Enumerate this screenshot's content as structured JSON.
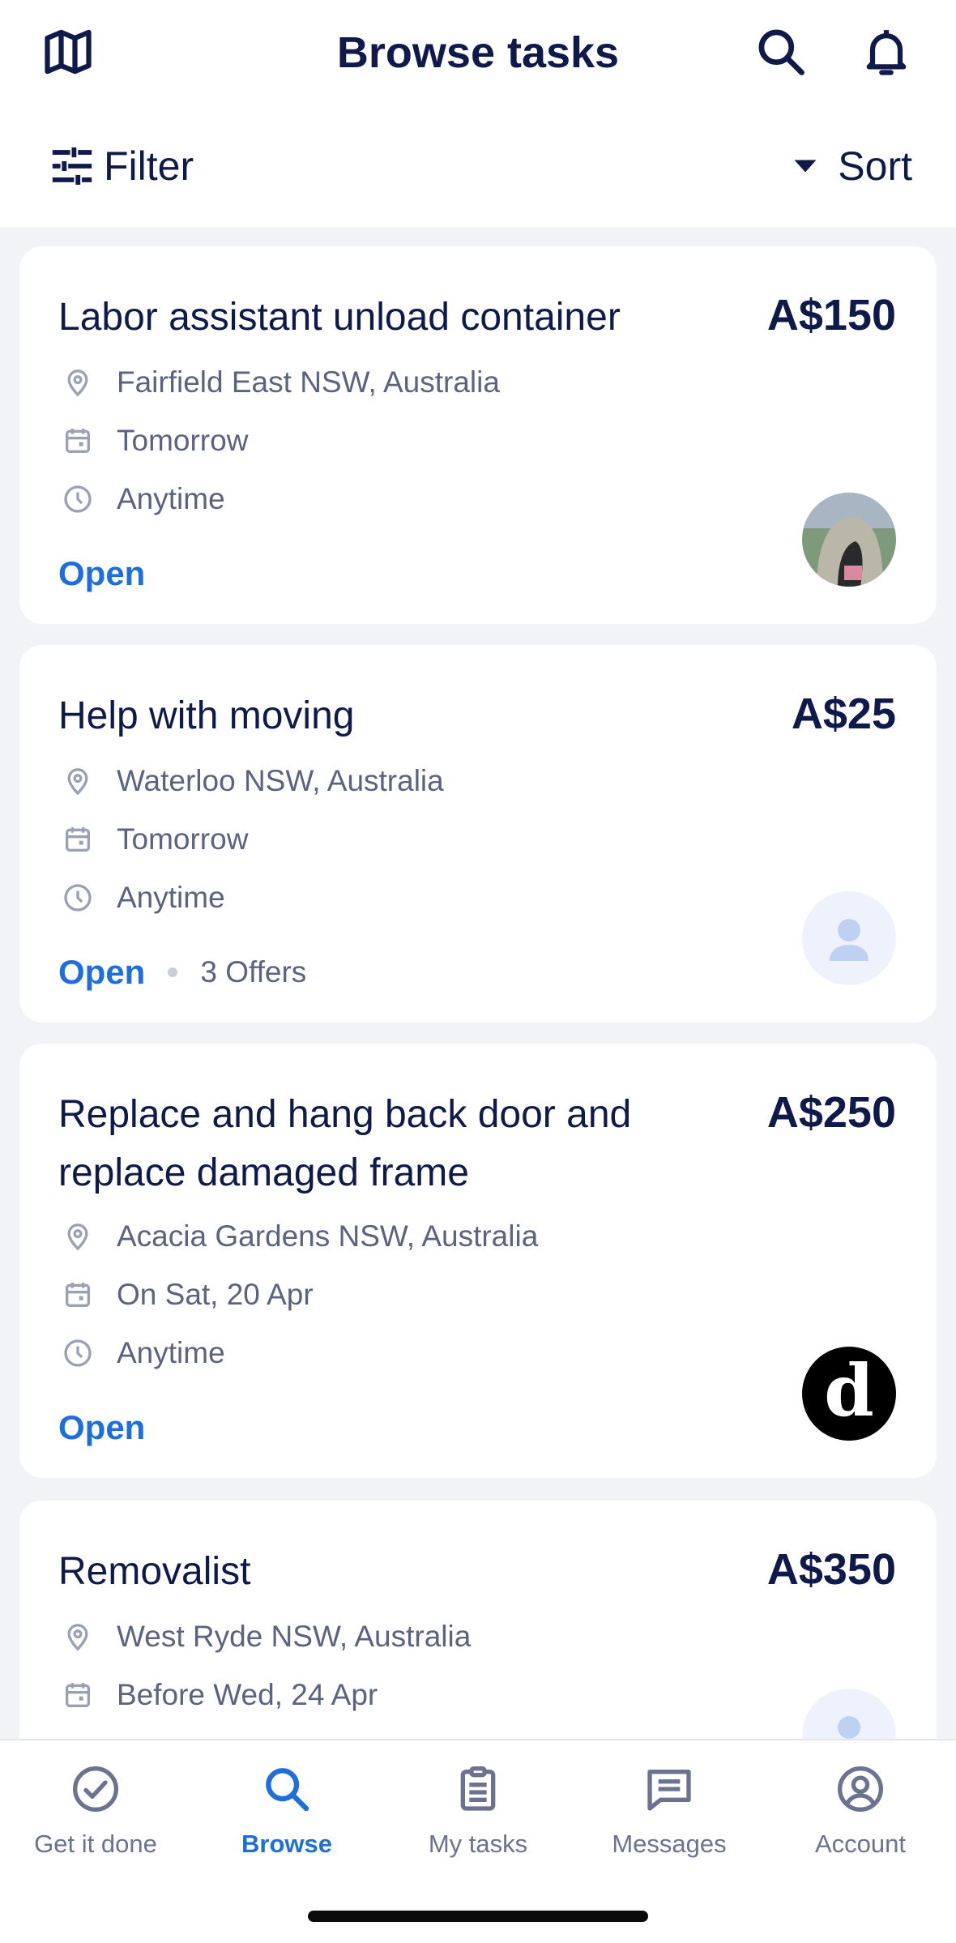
{
  "header": {
    "title": "Browse tasks"
  },
  "toolbar": {
    "filter_label": "Filter",
    "sort_label": "Sort"
  },
  "tasks": [
    {
      "title": "Labor assistant unload container",
      "price": "A$150",
      "location": "Fairfield East NSW, Australia",
      "date": "Tomorrow",
      "time": "Anytime",
      "status": "Open",
      "offers": "",
      "avatar": "photo"
    },
    {
      "title": "Help with moving",
      "price": "A$25",
      "location": "Waterloo NSW, Australia",
      "date": "Tomorrow",
      "time": "Anytime",
      "status": "Open",
      "offers": "3 Offers",
      "avatar": "placeholder"
    },
    {
      "title": "Replace and hang back door and replace damaged frame",
      "price": "A$250",
      "location": "Acacia Gardens NSW, Australia",
      "date": "On Sat, 20 Apr",
      "time": "Anytime",
      "status": "Open",
      "offers": "",
      "avatar": "logo"
    },
    {
      "title": "Removalist",
      "price": "A$350",
      "location": "West Ryde NSW, Australia",
      "date": "Before Wed, 24 Apr",
      "time": "",
      "status": "",
      "offers": "",
      "avatar": "placeholder"
    }
  ],
  "avatar_logo_letter": "d",
  "tabs": [
    {
      "label": "Get it done",
      "icon": "check-circle-icon",
      "active": false
    },
    {
      "label": "Browse",
      "icon": "search-icon",
      "active": true
    },
    {
      "label": "My tasks",
      "icon": "clipboard-icon",
      "active": false
    },
    {
      "label": "Messages",
      "icon": "message-icon",
      "active": false
    },
    {
      "label": "Account",
      "icon": "account-icon",
      "active": false
    }
  ],
  "colors": {
    "accent": "#1E6FDC",
    "text": "#0F1A4A",
    "muted": "#5B6381",
    "background": "#F2F3F7"
  }
}
